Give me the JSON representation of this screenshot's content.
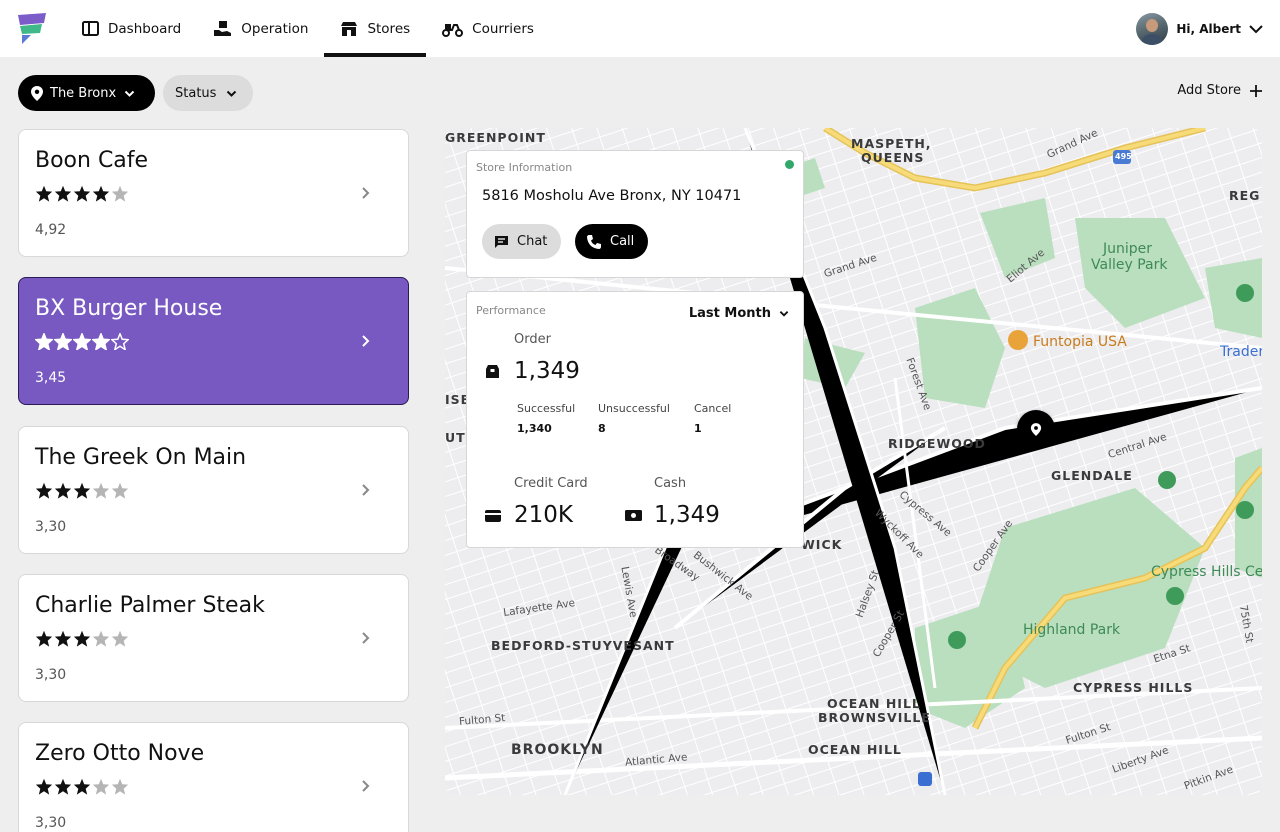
{
  "nav": {
    "items": [
      {
        "label": "Dashboard",
        "icon": "dashboard-icon"
      },
      {
        "label": "Operation",
        "icon": "operation-icon"
      },
      {
        "label": "Stores",
        "icon": "store-icon",
        "active": true
      },
      {
        "label": "Courriers",
        "icon": "scooter-icon"
      }
    ],
    "user_greeting": "Hi, Albert"
  },
  "filters": {
    "location": "The Bronx",
    "status": "Status"
  },
  "add_store_label": "Add Store",
  "stores": [
    {
      "name": "Boon Cafe",
      "stars": 4,
      "rating": "4,92",
      "selected": false
    },
    {
      "name": "BX Burger House",
      "stars": 4,
      "rating": "3,45",
      "selected": true
    },
    {
      "name": "The Greek On Main",
      "stars": 3,
      "rating": "3,30",
      "selected": false
    },
    {
      "name": "Charlie Palmer Steak",
      "stars": 3,
      "rating": "3,30",
      "selected": false
    },
    {
      "name": "Zero Otto Nove",
      "stars": 3,
      "rating": "3,30",
      "selected": false
    }
  ],
  "store_info": {
    "title": "Store Information",
    "status_color": "#2fa86a",
    "address": "5816 Mosholu Ave Bronx, NY 10471",
    "chat_label": "Chat",
    "call_label": "Call"
  },
  "performance": {
    "title": "Performance",
    "period": "Last Month",
    "order_label": "Order",
    "order_value": "1,349",
    "successful_label": "Successful",
    "successful_value": "1,340",
    "unsuccessful_label": "Unsuccessful",
    "unsuccessful_value": "8",
    "cancel_label": "Cancel",
    "cancel_value": "1",
    "credit_label": "Credit Card",
    "credit_value": "210K",
    "cash_label": "Cash",
    "cash_value": "1,349"
  },
  "map": {
    "areas": [
      "GREENPOINT",
      "MASPETH,",
      "QUEENS",
      "RIDGEWOOD",
      "GLENDALE",
      "BEDFORD-STUYVESANT",
      "OCEAN HILL",
      "BROWNSVILLE",
      "CYPRESS HILLS",
      "BROOKLYN",
      "OCEAN HILL",
      "WICK",
      "ISB",
      "UTH",
      "REG"
    ],
    "streets": [
      "Grand Ave",
      "Eliot Ave",
      "Forest Ave",
      "Central Ave",
      "Cypress Ave",
      "Wyckoff Ave",
      "Cooper Ave",
      "Halsey St",
      "Cooper St",
      "Bushwick Ave",
      "Lewis Ave",
      "Lafayette Ave",
      "Fulton St",
      "Atlantic Ave",
      "Etna St",
      "Liberty Ave",
      "Pitkin Ave",
      "75th St",
      "Grand Ave",
      "Broadway",
      "Fulton St"
    ],
    "parks": [
      "Juniper",
      "Valley Park",
      "Highland Park",
      "Cypress Hills Ce"
    ],
    "poi": "Funtopia USA",
    "poi_right": "Trader",
    "highway": "495",
    "accent_green": "#9fd5a5",
    "highway_color": "#f4d35e"
  },
  "colors": {
    "selected_card": "#7859c1",
    "primary": "#000000"
  }
}
